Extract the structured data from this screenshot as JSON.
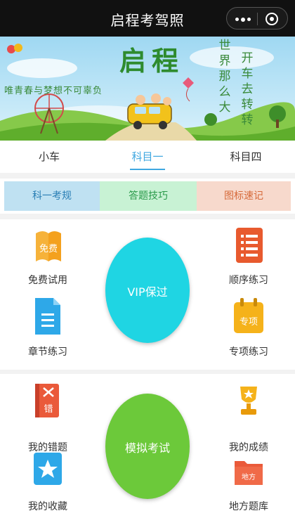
{
  "header": {
    "title": "启程考驾照"
  },
  "banner": {
    "title": "启程",
    "slogan": "唯青春与梦想不可辜负",
    "poem_col1": [
      "世",
      "界",
      "那",
      "么",
      "大"
    ],
    "poem_col2": [
      "开",
      "车",
      "去",
      "转",
      "转"
    ]
  },
  "tabs": [
    {
      "label": "小车"
    },
    {
      "label": "科目一"
    },
    {
      "label": "科目四"
    }
  ],
  "active_tab": "科目一",
  "subject_buttons": [
    {
      "label": "科一考规",
      "bg": "#bfe1f2",
      "color": "#2a7fb5"
    },
    {
      "label": "答题技巧",
      "bg": "#c8f2d4",
      "color": "#2a9a4a"
    },
    {
      "label": "图标速记",
      "bg": "#f7d9cc",
      "color": "#d66a3a"
    }
  ],
  "practice": {
    "free_trial": "免费试用",
    "free_icon_text": "免费",
    "sequential": "顺序练习",
    "chapter": "章节练习",
    "special": "专项练习",
    "special_icon_text": "专项",
    "vip": "VIP保过"
  },
  "exam": {
    "mistakes": "我的错题",
    "mistakes_icon_text": "错",
    "scores": "我的成绩",
    "favorites": "我的收藏",
    "regional": "地方题库",
    "regional_icon_text": "地方",
    "mock": "模拟考试"
  },
  "colors": {
    "accent": "#3fa7e0",
    "vip_circle": "#1fd5e3",
    "mock_circle": "#6cc93a"
  }
}
